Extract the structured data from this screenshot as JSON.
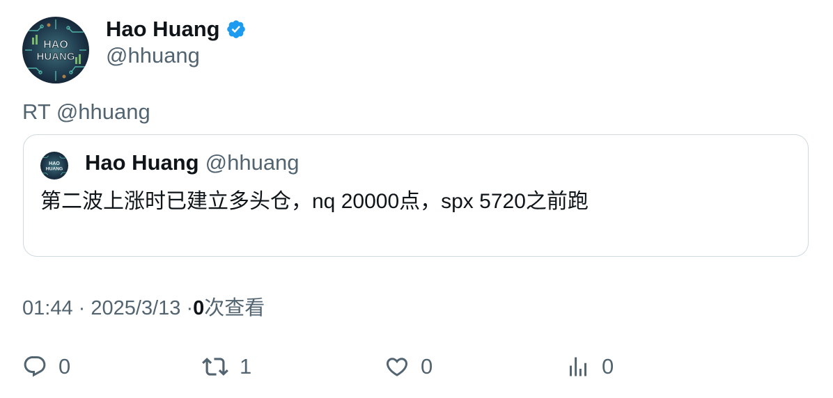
{
  "author": {
    "name": "Hao Huang",
    "handle": "@hhuang",
    "verified": true,
    "avatar_text": [
      "HAO",
      "HUANG"
    ]
  },
  "retweet_text": "RT @hhuang",
  "quoted": {
    "name": "Hao Huang",
    "handle": "@hhuang",
    "text": "第二波上涨时已建立多头仓，nq 20000点，spx 5720之前跑"
  },
  "meta": {
    "time": "01:44",
    "separator": "·",
    "date": "2025/3/13",
    "views_count": "0",
    "views_label": "次查看"
  },
  "actions": {
    "reply": {
      "icon": "reply-icon",
      "count": "0"
    },
    "retweet": {
      "icon": "retweet-icon",
      "count": "1"
    },
    "like": {
      "icon": "heart-icon",
      "count": "0"
    },
    "views": {
      "icon": "bar-chart-icon",
      "count": "0"
    }
  },
  "colors": {
    "text_primary": "#0f1419",
    "text_secondary": "#536471",
    "border": "#cfd9de",
    "verified_blue": "#1d9bf0"
  }
}
